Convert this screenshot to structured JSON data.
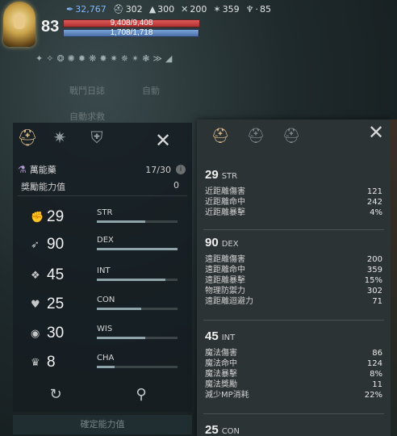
{
  "hud": {
    "level": "83",
    "stats": [
      {
        "icon": "feather-icon",
        "glyph": "✒",
        "value": "32,767",
        "blue": true
      },
      {
        "icon": "helmet-icon",
        "glyph": "⛑",
        "value": "302"
      },
      {
        "icon": "boot-icon",
        "glyph": "▲",
        "value": "300"
      },
      {
        "icon": "crossed-swords-icon",
        "glyph": "✕",
        "value": "200"
      },
      {
        "icon": "bird-icon",
        "glyph": "✶",
        "value": "359"
      },
      {
        "icon": "trophy-icon",
        "glyph": "♆",
        "value": "85"
      }
    ],
    "hp_text": "9,408/9,408",
    "hp_fraction": 1.0,
    "mp_text": "1,708/1,718",
    "mp_fraction": 0.994,
    "bg_label_1": "戰鬥日誌",
    "bg_label_2": "自動",
    "bg_label_3": "自動求救"
  },
  "left_panel": {
    "potion_name": "萬能藥",
    "potion_count": "17/30",
    "bonus_label": "獎勵能力值",
    "bonus_value": "0",
    "stats": [
      {
        "icon": "strength-arm-icon",
        "glyph": "✊",
        "value": "29",
        "name": "STR",
        "fill": 0.6
      },
      {
        "icon": "dexterity-boot-icon",
        "glyph": "➶",
        "value": "90",
        "name": "DEX",
        "fill": 1.0
      },
      {
        "icon": "intelligence-book-icon",
        "glyph": "❖",
        "value": "45",
        "name": "INT",
        "fill": 0.85
      },
      {
        "icon": "constitution-heart-icon",
        "glyph": "♥",
        "value": "25",
        "name": "CON",
        "fill": 0.55
      },
      {
        "icon": "wisdom-head-icon",
        "glyph": "◉",
        "value": "30",
        "name": "WIS",
        "fill": 0.6
      },
      {
        "icon": "charisma-crown-icon",
        "glyph": "♛",
        "value": "8",
        "name": "CHA",
        "fill": 0.22
      }
    ],
    "confirm_label": "確定能力值"
  },
  "right_panel": {
    "sections": [
      {
        "value": "29",
        "name": "STR",
        "rows": [
          {
            "label": "近距離傷害",
            "value": "121"
          },
          {
            "label": "近距離命中",
            "value": "242"
          },
          {
            "label": "近距離暴擊",
            "value": "4%"
          }
        ]
      },
      {
        "value": "90",
        "name": "DEX",
        "rows": [
          {
            "label": "遠距離傷害",
            "value": "200"
          },
          {
            "label": "遠距離命中",
            "value": "359"
          },
          {
            "label": "遠距離暴擊",
            "value": "15%"
          },
          {
            "label": "物理防禦力",
            "value": "302"
          },
          {
            "label": "遠距離迴避力",
            "value": "71"
          }
        ]
      },
      {
        "value": "45",
        "name": "INT",
        "rows": [
          {
            "label": "魔法傷害",
            "value": "86"
          },
          {
            "label": "魔法命中",
            "value": "124"
          },
          {
            "label": "魔法暴擊",
            "value": "8%"
          },
          {
            "label": "魔法獎勵",
            "value": "11"
          },
          {
            "label": "減少MP消耗",
            "value": "22%"
          }
        ]
      },
      {
        "value": "25",
        "name": "CON",
        "rows": []
      }
    ]
  },
  "colors": {
    "accent_gold": "#d8b98a",
    "hp_red": "#c94444",
    "mp_blue": "#5a82bf",
    "panel_bg": "#2c3335"
  }
}
